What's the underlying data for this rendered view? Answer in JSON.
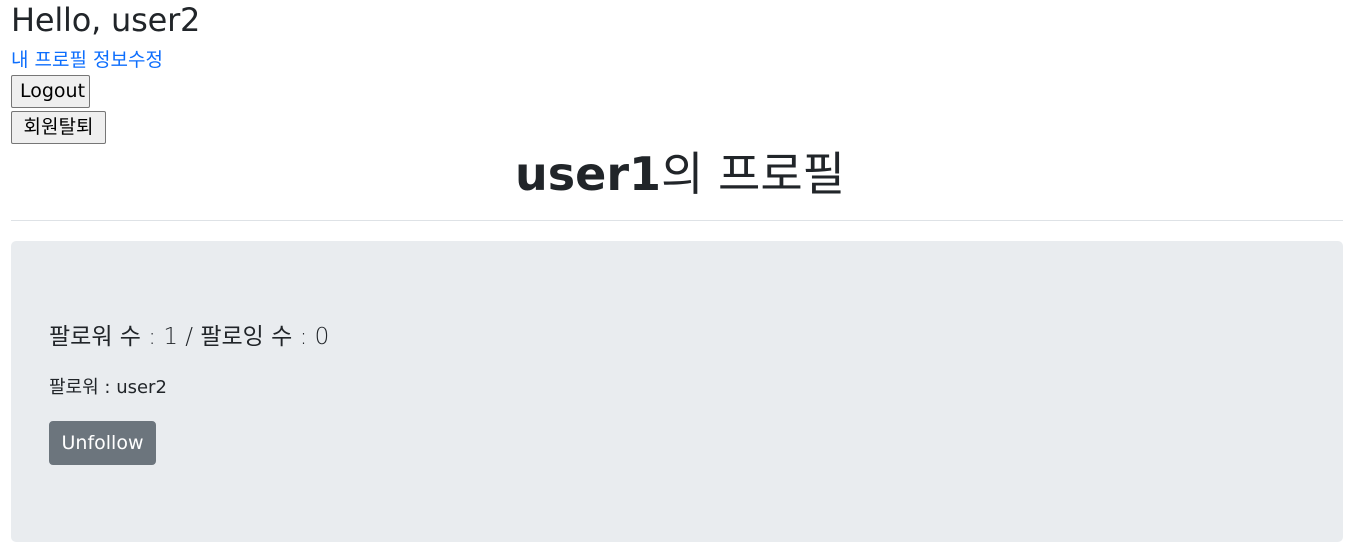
{
  "header": {
    "greeting": "Hello, user2",
    "profile_link": "내 프로필 정보수정",
    "logout_label": "Logout",
    "withdraw_label": "회원탈퇴"
  },
  "profile": {
    "username": "user1",
    "title_suffix": "의 프로필"
  },
  "stats": {
    "followers_label": "팔로워 수 : ",
    "followers_count": "1",
    "separator": " / ",
    "following_label": "팔로잉 수 : ",
    "following_count": "0",
    "followers_list_label": "팔로워 : ",
    "followers_list": "user2"
  },
  "actions": {
    "unfollow_label": "Unfollow"
  },
  "colors": {
    "link": "#0d6efd",
    "panel_bg": "#e9ecef",
    "secondary_button": "#6c757d"
  }
}
